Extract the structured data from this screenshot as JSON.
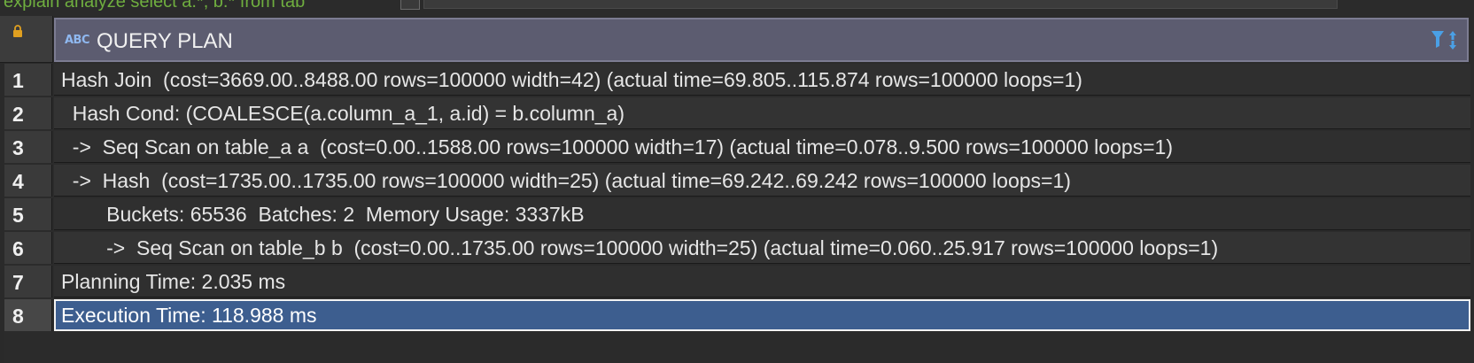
{
  "editor": {
    "visible_text": "explain analyze select a.*, b.* from tab",
    "keyword": "from"
  },
  "grid": {
    "column_header": "QUERY PLAN",
    "column_type_badge": "ABC",
    "icons": {
      "corner": "lock-icon",
      "column_type": "text-type-icon",
      "column_sort": "filter-sort-icon"
    },
    "colors": {
      "header_bg": "#5c5c70",
      "selected_row_bg": "#3d5e8f",
      "lock_icon": "#e0a020",
      "sort_icon": "#4aa0e6"
    },
    "rows": [
      {
        "num": "1",
        "text": "Hash Join  (cost=3669.00..8488.00 rows=100000 width=42) (actual time=69.805..115.874 rows=100000 loops=1)"
      },
      {
        "num": "2",
        "text": "  Hash Cond: (COALESCE(a.column_a_1, a.id) = b.column_a)"
      },
      {
        "num": "3",
        "text": "  ->  Seq Scan on table_a a  (cost=0.00..1588.00 rows=100000 width=17) (actual time=0.078..9.500 rows=100000 loops=1)"
      },
      {
        "num": "4",
        "text": "  ->  Hash  (cost=1735.00..1735.00 rows=100000 width=25) (actual time=69.242..69.242 rows=100000 loops=1)"
      },
      {
        "num": "5",
        "text": "        Buckets: 65536  Batches: 2  Memory Usage: 3337kB"
      },
      {
        "num": "6",
        "text": "        ->  Seq Scan on table_b b  (cost=0.00..1735.00 rows=100000 width=25) (actual time=0.060..25.917 rows=100000 loops=1)"
      },
      {
        "num": "7",
        "text": "Planning Time: 2.035 ms"
      },
      {
        "num": "8",
        "text": "Execution Time: 118.988 ms"
      }
    ],
    "selected_row": "8"
  }
}
